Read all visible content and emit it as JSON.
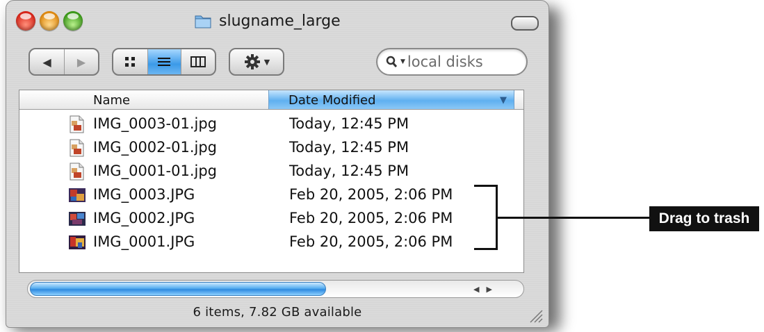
{
  "window": {
    "title": "slugname_large"
  },
  "toolbar": {
    "back_icon": "◀",
    "forward_icon": "▶",
    "view_icon_icon": "icon-view-icon",
    "view_list_icon": "list-view-icon",
    "view_column_icon": "column-view-icon",
    "action_icon": "gear-icon",
    "search_placeholder": "local disks"
  },
  "list": {
    "columns": {
      "name": "Name",
      "date": "Date Modified"
    },
    "rows": [
      {
        "name": "IMG_0003-01.jpg",
        "date": "Today, 12:45 PM",
        "icon": "jpeg-document-icon"
      },
      {
        "name": "IMG_0002-01.jpg",
        "date": "Today, 12:45 PM",
        "icon": "jpeg-document-icon"
      },
      {
        "name": "IMG_0001-01.jpg",
        "date": "Today, 12:45 PM",
        "icon": "jpeg-document-icon"
      },
      {
        "name": "IMG_0003.JPG",
        "date": "Feb 20, 2005, 2:06 PM",
        "icon": "photo-thumbnail-icon"
      },
      {
        "name": "IMG_0002.JPG",
        "date": "Feb 20, 2005, 2:06 PM",
        "icon": "photo-thumbnail-icon"
      },
      {
        "name": "IMG_0001.JPG",
        "date": "Feb 20, 2005, 2:06 PM",
        "icon": "photo-thumbnail-icon"
      }
    ]
  },
  "status": {
    "text": "6 items, 7.82 GB available"
  },
  "annotation": {
    "label": "Drag to trash"
  },
  "colors": {
    "accent_blue": "#3c9ae8",
    "callout_bg": "#111111",
    "callout_text": "#ffffff"
  }
}
